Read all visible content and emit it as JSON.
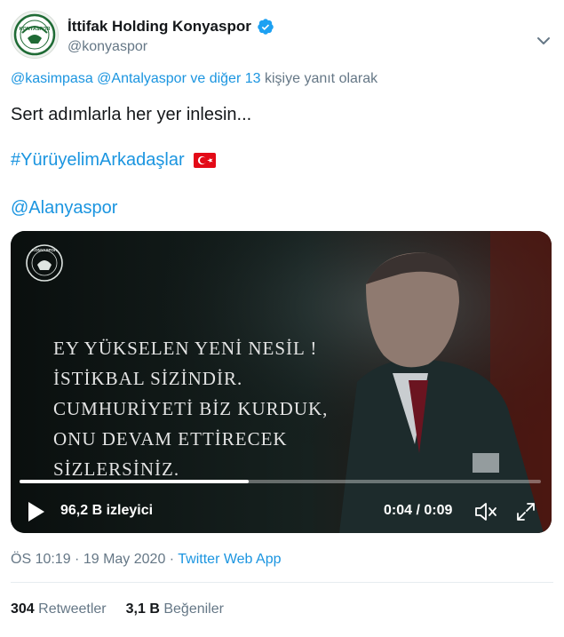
{
  "author": {
    "display_name": "İttifak Holding Konyaspor",
    "handle": "@konyaspor",
    "avatar_icon": "konyaspor-crest-icon",
    "verified_icon": "verified-badge-icon",
    "avatar_text": "KONYASPOR"
  },
  "reply": {
    "mention1": "@kasimpasa",
    "mention2": "@Antalyaspor",
    "others": "ve diğer 13",
    "suffix": "kişiye yanıt olarak"
  },
  "tweet": {
    "line1": "Sert adımlarla her yer inlesin...",
    "hashtag": "#YürüyelimArkadaşlar",
    "mention": "@Alanyaspor"
  },
  "video": {
    "logo_text": "KONYASPOR",
    "quote_lines": [
      "EY YÜKSELEN YENİ NESİL !",
      "İSTİKBAL SİZİNDİR.",
      "CUMHURİYETİ BİZ KURDUK,",
      "ONU DEVAM ETTİRECEK",
      "SİZLERSİNİZ."
    ],
    "views": "96,2 B izleyici",
    "time": "0:04 / 0:09",
    "progress": 0.44
  },
  "meta": {
    "time": "ÖS 10:19",
    "date": "19 May 2020",
    "source": "Twitter Web App",
    "separator": " · "
  },
  "stats": {
    "retweets_count": "304",
    "retweets_label": "Retweetler",
    "likes_count": "3,1 B",
    "likes_label": "Beğeniler"
  },
  "colors": {
    "link": "#1b95e0",
    "secondary": "#657786",
    "primary_text": "#14171a"
  }
}
